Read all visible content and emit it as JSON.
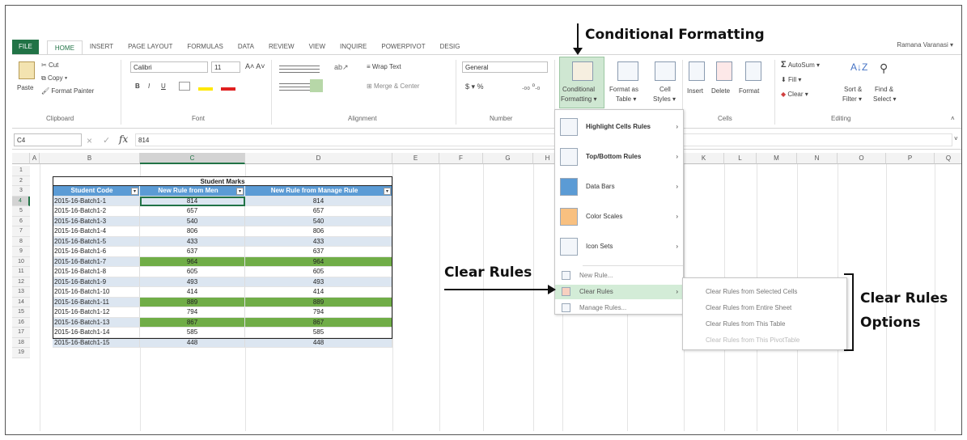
{
  "tabs": [
    "FILE",
    "HOME",
    "INSERT",
    "PAGE LAYOUT",
    "FORMULAS",
    "DATA",
    "REVIEW",
    "VIEW",
    "INQUIRE",
    "POWERPIVOT",
    "DESIG"
  ],
  "active_tab": "HOME",
  "user": "Ramana Varanasi ▾",
  "ribbon": {
    "clipboard": {
      "paste": "Paste",
      "cut": "Cut",
      "copy": "Copy ▾",
      "format_painter": "Format Painter",
      "label": "Clipboard"
    },
    "font": {
      "name": "Calibri",
      "size": "11",
      "label": "Font",
      "bold": "B",
      "italic": "I",
      "underline": "U"
    },
    "alignment": {
      "wrap": "Wrap Text",
      "merge": "Merge & Center",
      "label": "Alignment"
    },
    "number": {
      "format": "General",
      "currency": "$ ▾ %",
      "label": "Number"
    },
    "styles": {
      "cond_fmt_1": "Conditional",
      "cond_fmt_2": "Formatting ▾",
      "fmt_table_1": "Format as",
      "fmt_table_2": "Table ▾",
      "cell_styles_1": "Cell",
      "cell_styles_2": "Styles ▾"
    },
    "cells": {
      "insert": "Insert",
      "delete": "Delete",
      "format": "Format",
      "label": "Cells"
    },
    "editing": {
      "autosum": "AutoSum ▾",
      "fill": "Fill ▾",
      "clear": "Clear ▾",
      "sort_1": "Sort &",
      "sort_2": "Filter ▾",
      "find_1": "Find &",
      "find_2": "Select ▾",
      "label": "Editing"
    }
  },
  "formula_bar": {
    "name_box": "C4",
    "fx": "fx",
    "value": "814"
  },
  "columns": [
    "A",
    "B",
    "C",
    "D",
    "E",
    "F",
    "G",
    "H",
    "I",
    "J",
    "K",
    "L",
    "M",
    "N",
    "O",
    "P",
    "Q"
  ],
  "row_numbers": [
    "1",
    "2",
    "3",
    "4",
    "5",
    "6",
    "7",
    "8",
    "9",
    "10",
    "11",
    "12",
    "13",
    "14",
    "15",
    "16",
    "17",
    "18",
    "19"
  ],
  "table": {
    "title": "Student Marks",
    "headers": [
      "Student Code",
      "New Rule from Men",
      "New Rule from Manage Rule"
    ],
    "rows": [
      [
        "2015-16-Batch1-1",
        "814",
        "814"
      ],
      [
        "2015-16-Batch1-2",
        "657",
        "657"
      ],
      [
        "2015-16-Batch1-3",
        "540",
        "540"
      ],
      [
        "2015-16-Batch1-4",
        "806",
        "806"
      ],
      [
        "2015-16-Batch1-5",
        "433",
        "433"
      ],
      [
        "2015-16-Batch1-6",
        "637",
        "637"
      ],
      [
        "2015-16-Batch1-7",
        "964",
        "964"
      ],
      [
        "2015-16-Batch1-8",
        "605",
        "605"
      ],
      [
        "2015-16-Batch1-9",
        "493",
        "493"
      ],
      [
        "2015-16-Batch1-10",
        "414",
        "414"
      ],
      [
        "2015-16-Batch1-11",
        "889",
        "889"
      ],
      [
        "2015-16-Batch1-12",
        "794",
        "794"
      ],
      [
        "2015-16-Batch1-13",
        "867",
        "867"
      ],
      [
        "2015-16-Batch1-14",
        "585",
        "585"
      ],
      [
        "2015-16-Batch1-15",
        "448",
        "448"
      ]
    ]
  },
  "cf_menu": [
    "Highlight Cells Rules",
    "Top/Bottom Rules",
    "Data Bars",
    "Color Scales",
    "Icon Sets",
    "New Rule...",
    "Clear Rules",
    "Manage Rules..."
  ],
  "clear_submenu": [
    "Clear Rules from Selected Cells",
    "Clear Rules from Entire Sheet",
    "Clear Rules from This Table",
    "Clear Rules from This PivotTable"
  ],
  "annotations": {
    "cf": "Conditional Formatting",
    "clear_rules": "Clear Rules",
    "options_1": "Clear Rules",
    "options_2": "Options"
  },
  "colors": {
    "accent": "#217346",
    "header_blue": "#5b9bd5",
    "band": "#dce6f1",
    "green_fill": "#70ad47",
    "menu_hover": "#d3ecd7"
  }
}
